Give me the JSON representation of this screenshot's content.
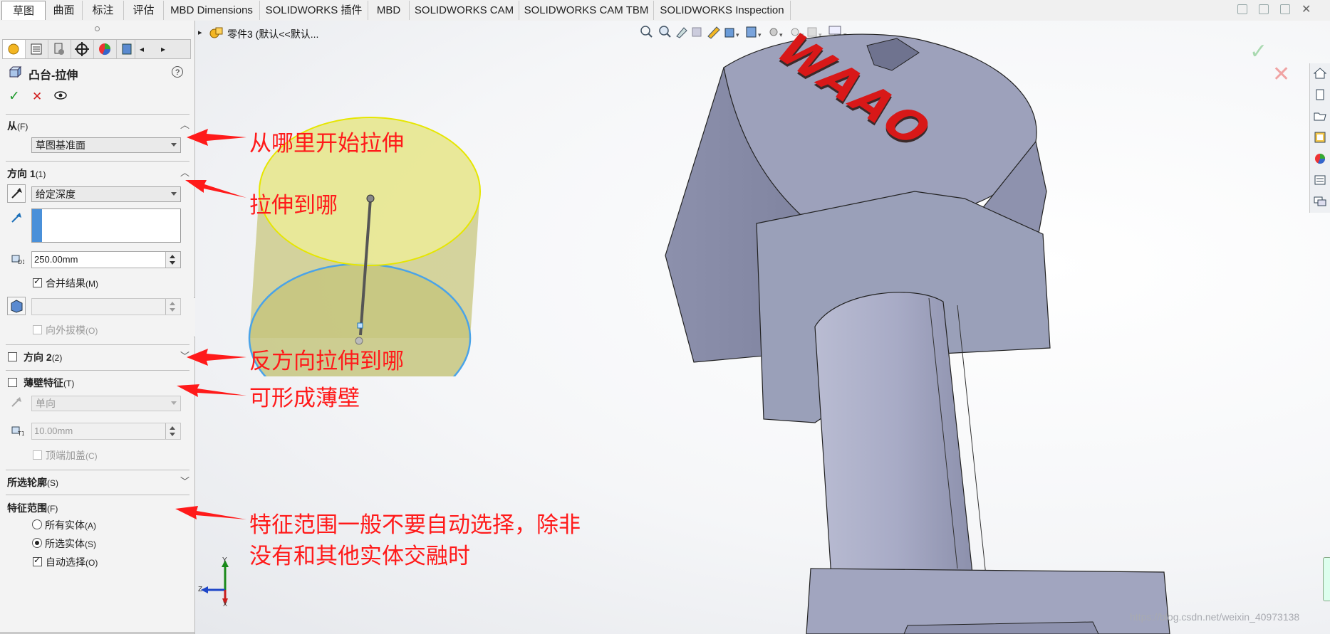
{
  "tabs": [
    "草图",
    "曲面",
    "标注",
    "评估",
    "MBD Dimensions",
    "SOLIDWORKS 插件",
    "MBD",
    "SOLIDWORKS CAM",
    "SOLIDWORKS CAM TBM",
    "SOLIDWORKS Inspection"
  ],
  "active_tab": "草图",
  "feature": {
    "title": "凸台-拉伸",
    "help": "?",
    "ok": "✓",
    "cancel": "✕"
  },
  "from": {
    "label": "从",
    "shortcut": "(F)",
    "value": "草图基准面"
  },
  "direction1": {
    "label": "方向 1",
    "shortcut": "(1)",
    "end_condition": "给定深度",
    "depth": "250.00mm",
    "merge_label": "合并结果",
    "merge_shortcut": "(M)",
    "merge_checked": true,
    "draft_label": "向外拔模",
    "draft_shortcut": "(O)"
  },
  "direction2": {
    "label": "方向 2",
    "shortcut": "(2)",
    "checked": false
  },
  "thin": {
    "label": "薄壁特征",
    "shortcut": "(T)",
    "checked": false,
    "type": "单向",
    "thickness": "10.00mm",
    "cap_label": "顶端加盖",
    "cap_shortcut": "(C)"
  },
  "contours": {
    "label": "所选轮廓",
    "shortcut": "(S)"
  },
  "scope": {
    "label": "特征范围",
    "shortcut": "(F)",
    "options": [
      {
        "label": "所有实体",
        "shortcut": "(A)",
        "selected": false
      },
      {
        "label": "所选实体",
        "shortcut": "(S)",
        "selected": true
      }
    ],
    "auto_label": "自动选择",
    "auto_shortcut": "(O)",
    "auto_checked": true
  },
  "breadcrumb": "零件3  (默认<<默认...",
  "annotations": {
    "from": "从哪里开始拉伸",
    "to": "拉伸到哪",
    "reverse": "反方向拉伸到哪",
    "thin": "可形成薄壁",
    "scope_line1": "特征范围一般不要自动选择，除非",
    "scope_line2": "没有和其他实体交融时"
  },
  "model_text": "WAAO",
  "triad": {
    "x": "X",
    "y": "Y",
    "z": "Z"
  },
  "watermark": "https://blog.csdn.net/weixin_40973138",
  "colors": {
    "annotation": "#ff1a1a",
    "preview_fill": "#eeee99",
    "preview_edge_top": "#e6e600",
    "preview_edge_bottom": "#4aa3e8",
    "part_body": "#9a9eb8",
    "logo_red": "#d81818",
    "accent_blue": "#4a90d9"
  }
}
